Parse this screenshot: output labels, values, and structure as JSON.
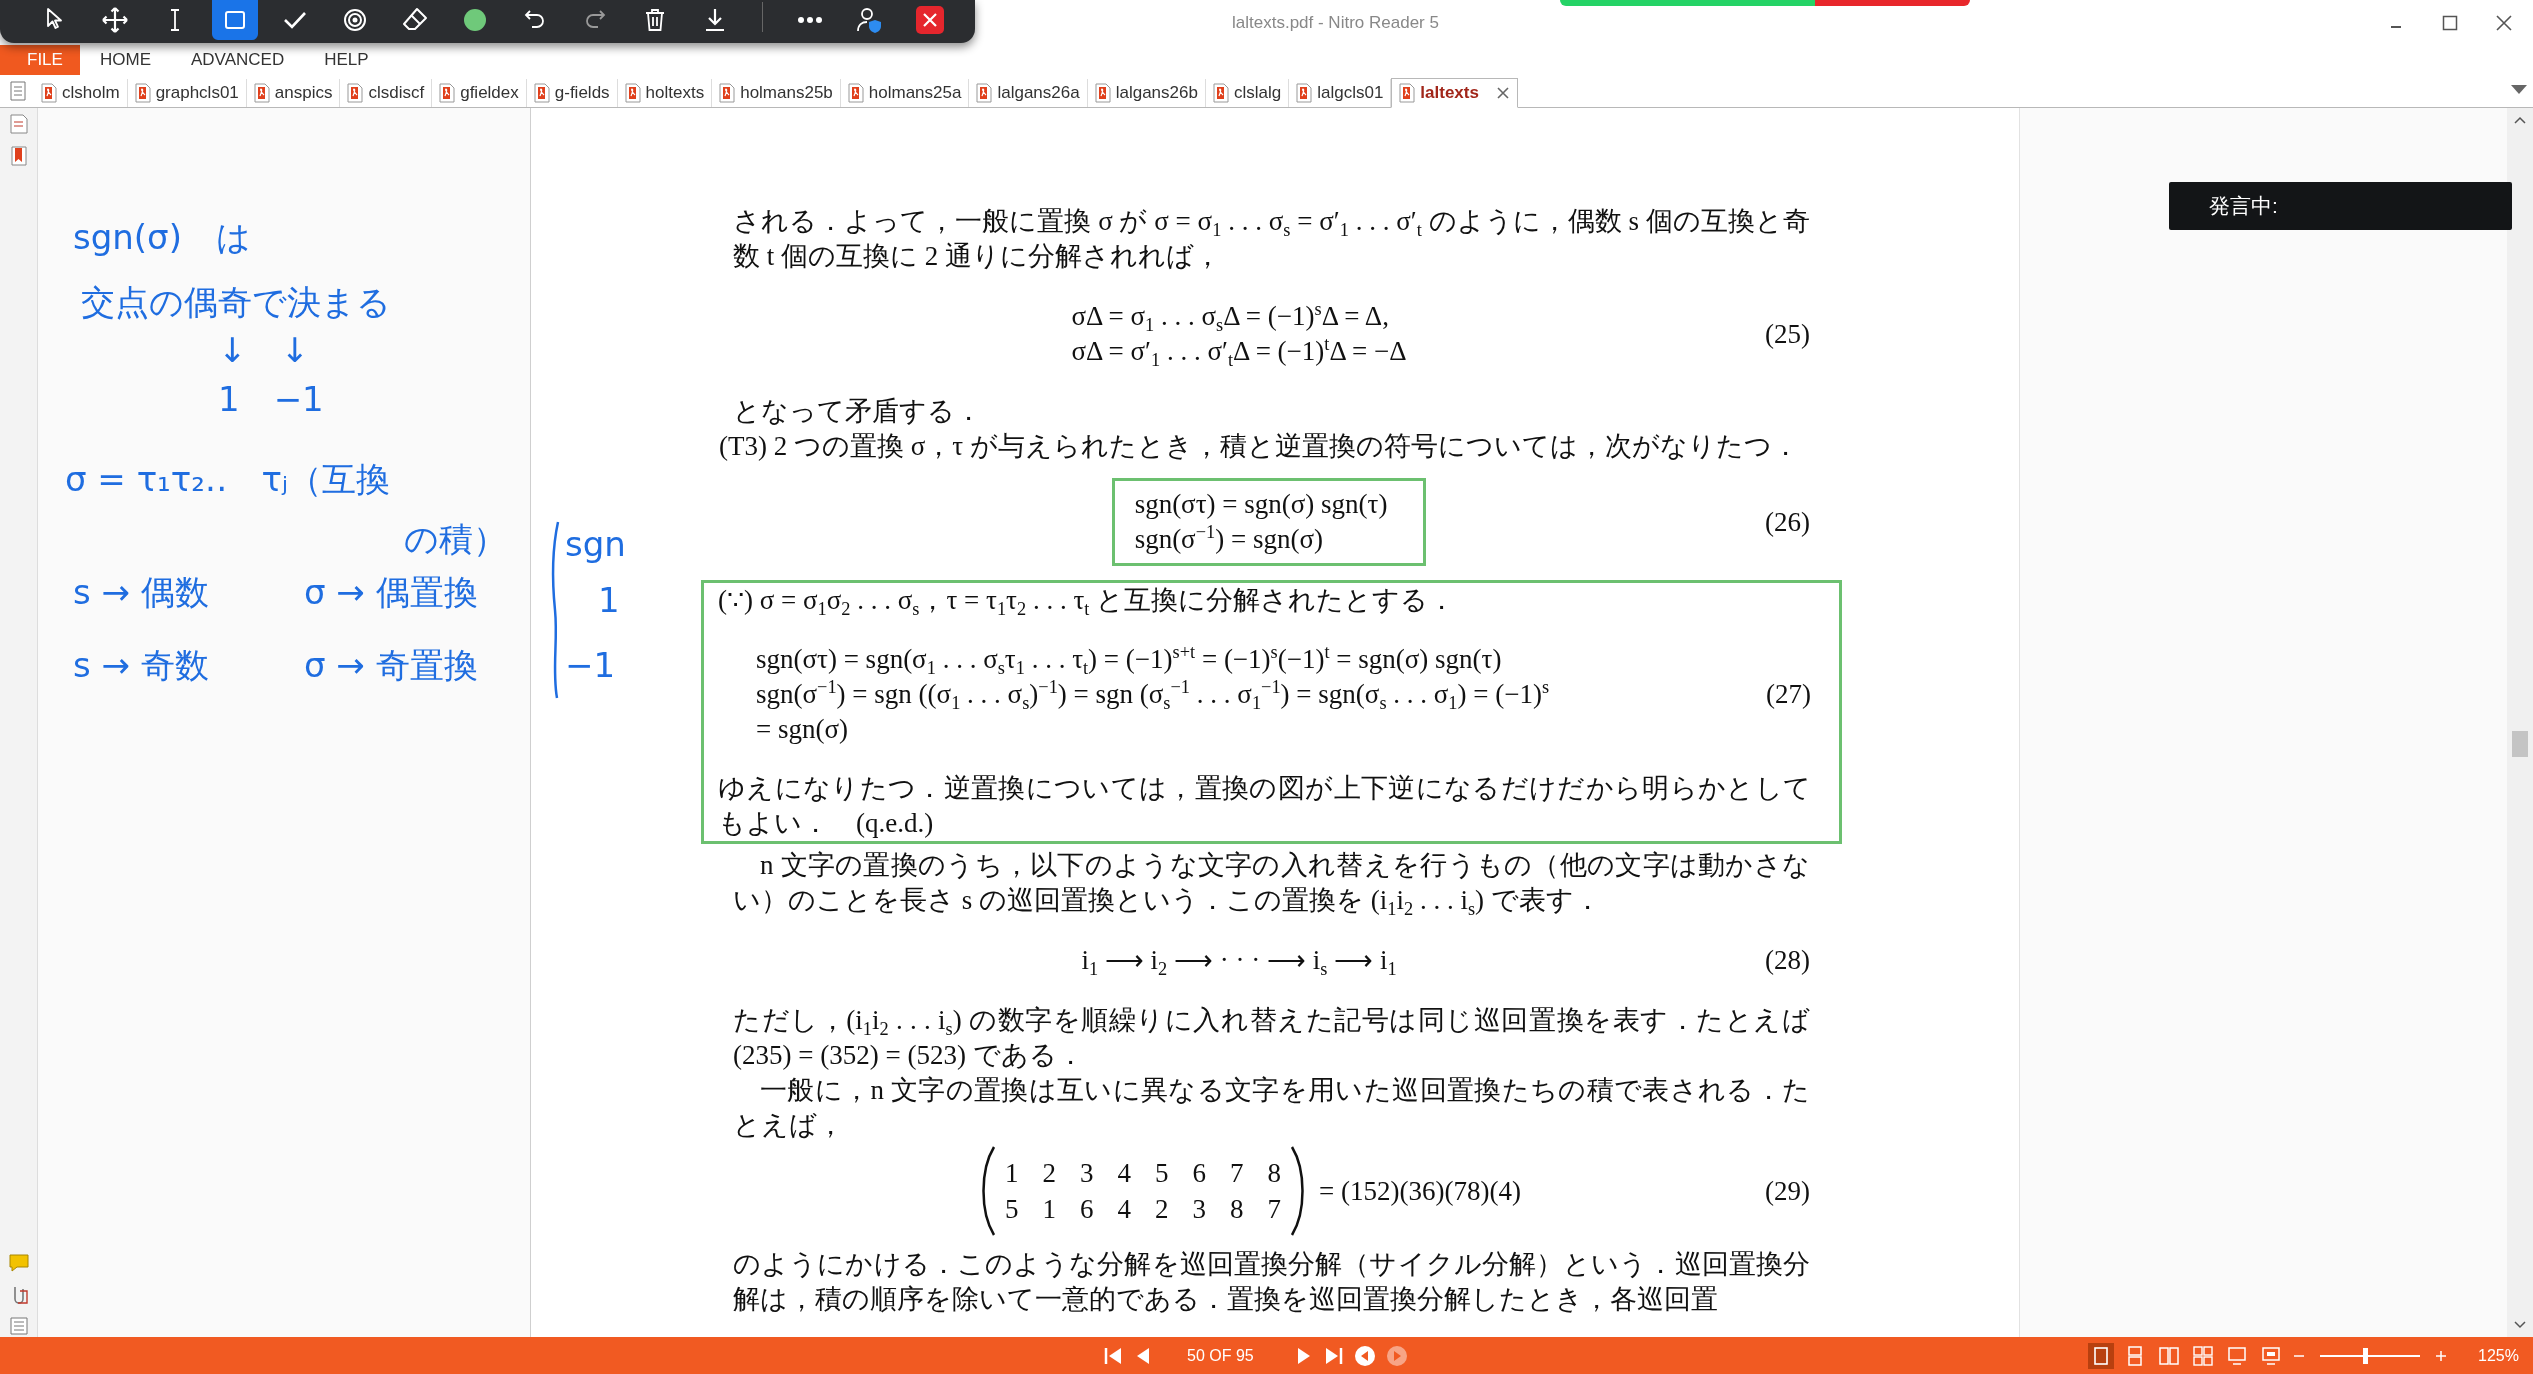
{
  "window": {
    "title": "laltexts.pdf - Nitro Reader 5"
  },
  "annotation_toolbar": {
    "tools": [
      {
        "kind": "pointer",
        "selected": false
      },
      {
        "kind": "move",
        "selected": false
      },
      {
        "kind": "text",
        "selected": false
      },
      {
        "kind": "rectangle",
        "selected": true
      },
      {
        "kind": "check",
        "selected": false
      },
      {
        "kind": "record",
        "selected": false
      },
      {
        "kind": "eraser",
        "selected": false
      },
      {
        "kind": "color",
        "selected": false
      },
      {
        "kind": "undo",
        "selected": false
      },
      {
        "kind": "redo",
        "selected": false
      },
      {
        "kind": "delete",
        "selected": false
      },
      {
        "kind": "download",
        "selected": false
      },
      {
        "kind": "more",
        "selected": false
      },
      {
        "kind": "user",
        "selected": false
      },
      {
        "kind": "close",
        "selected": false
      }
    ]
  },
  "menu": [
    {
      "label": "FILE",
      "selected": true
    },
    {
      "label": "HOME",
      "selected": false
    },
    {
      "label": "ADVANCED",
      "selected": false
    },
    {
      "label": "HELP",
      "selected": false
    }
  ],
  "tabs": [
    {
      "label": "clsholm",
      "selected": false
    },
    {
      "label": "graphcls01",
      "selected": false
    },
    {
      "label": "anspics",
      "selected": false
    },
    {
      "label": "clsdiscf",
      "selected": false
    },
    {
      "label": "gfieldex",
      "selected": false
    },
    {
      "label": "g-fields",
      "selected": false
    },
    {
      "label": "holtexts",
      "selected": false
    },
    {
      "label": "holmans25b",
      "selected": false
    },
    {
      "label": "holmans25a",
      "selected": false
    },
    {
      "label": "lalgans26a",
      "selected": false
    },
    {
      "label": "lalgans26b",
      "selected": false
    },
    {
      "label": "clslalg",
      "selected": false
    },
    {
      "label": "lalgcls01",
      "selected": false
    },
    {
      "label": "laltexts",
      "selected": true
    }
  ],
  "ink_notes": [
    "sgn(σ)　は",
    "交点の偶奇で決まる",
    "↓　↓",
    "1　−1",
    "σ = τ₁τ₂‥　τⱼ（互換",
    "の積）",
    "sgn",
    "s → 偶数",
    "σ → 偶置換",
    "1",
    "s → 奇数",
    "σ → 奇置換",
    "−1"
  ],
  "popup": {
    "text": "発言中:"
  },
  "document": {
    "blocks": [
      {
        "kind": "text",
        "text": "される．よって，一般に置換 σ が σ = σ$_{1}$ . . . σ$_{s}$ = σ′$_{1}$ . . . σ′$_{t}$ のように，偶数 s 個の互換と奇数 t 個の互換に 2 通りに分解されれば，"
      },
      {
        "kind": "equation",
        "lines": [
          "σΔ = σ$_{1}$ . . . σ$_{s}$Δ = (−1)$^{s}$Δ = Δ,",
          "σΔ = σ′$_{1}$ . . . σ′$_{t}$Δ = (−1)$^{t}$Δ = −Δ"
        ],
        "number": "(25)"
      },
      {
        "kind": "text",
        "text": "となって矛盾する．"
      },
      {
        "kind": "outdented",
        "text": "(T3) 2 つの置換 σ，τ が与えられたとき，積と逆置換の符号については，次がなりたつ．"
      },
      {
        "kind": "equation",
        "framed": true,
        "lines": [
          "sgn(στ) = sgn(σ) sgn(τ)",
          "sgn(σ$^{−1}$) = sgn(σ)"
        ],
        "number": "(26)"
      },
      {
        "kind": "frame",
        "blocks": [
          {
            "kind": "text",
            "text": "(∵) σ = σ$_{1}$σ$_{2}$ . . . σ$_{s}$，τ = τ$_{1}$τ$_{2}$ . . . τ$_{t}$ と互換に分解されたとする．"
          },
          {
            "kind": "equation",
            "lines": [
              "sgn(στ) = sgn(σ$_{1}$ . . . σ$_{s}$τ$_{1}$ . . . τ$_{t}$) = (−1)$^{s+t}$ = (−1)$^{s}$(−1)$^{t}$ = sgn(σ) sgn(τ)",
              "sgn(σ$^{−1}$) = sgn ((σ$_{1}$ . . . σ$_{s}$)$^{−1}$) = sgn (σ$_{s}$$^{−1}$ . . . σ$_{1}$$^{−1}$) = sgn(σ$_{s}$ . . . σ$_{1}$) = (−1)$^{s}$",
              "= sgn(σ)"
            ],
            "number": "(27)"
          },
          {
            "kind": "text",
            "text": "ゆえになりたつ．逆置換については，置換の図が上下逆になるだけだから明らかとしてもよい．　(q.e.d.)"
          }
        ]
      },
      {
        "kind": "indented",
        "text": "n 文字の置換のうち，以下のような文字の入れ替えを行うもの（他の文字は動かさない）のことを長さ s の巡回置換という．この置換を (i$_{1}$i$_{2}$ . . . i$_{s}$) で表す．"
      },
      {
        "kind": "equation",
        "lines": [
          "i$_{1}$ ⟶ i$_{2}$ ⟶ · · · ⟶ i$_{s}$ ⟶ i$_{1}$"
        ],
        "number": "(28)"
      },
      {
        "kind": "text",
        "text": "ただし，(i$_{1}$i$_{2}$ . . . i$_{s}$) の数字を順繰りに入れ替えた記号は同じ巡回置換を表す．たとえば (235) = (352) = (523) である．"
      },
      {
        "kind": "indented",
        "text": "一般に，n 文字の置換は互いに異なる文字を用いた巡回置換たちの積で表される．たとえば，"
      },
      {
        "kind": "matrix",
        "rows": [
          [
            "1",
            "2",
            "3",
            "4",
            "5",
            "6",
            "7",
            "8"
          ],
          [
            "5",
            "1",
            "6",
            "4",
            "2",
            "3",
            "8",
            "7"
          ]
        ],
        "rhs": "= (152)(36)(78)(4)",
        "number": "(29)"
      },
      {
        "kind": "text",
        "text": "のようにかける．このような分解を巡回置換分解（サイクル分解）という．巡回置換分解は，積の順序を除いて一意的である．置換を巡回置換分解したとき，各巡回置"
      }
    ]
  },
  "status_bar": {
    "page_indicator": "50 OF 95",
    "history": [
      {
        "kind": "back",
        "disabled": false
      },
      {
        "kind": "forward",
        "disabled": true
      }
    ],
    "views": [
      {
        "kind": "single",
        "selected": true
      },
      {
        "kind": "continuous",
        "selected": false
      },
      {
        "kind": "facing",
        "selected": false
      },
      {
        "kind": "facing_continuous",
        "selected": false
      },
      {
        "kind": "cover",
        "selected": false
      },
      {
        "kind": "full",
        "selected": false
      }
    ],
    "zoom": {
      "level": 0.45,
      "reading": "125%"
    }
  }
}
